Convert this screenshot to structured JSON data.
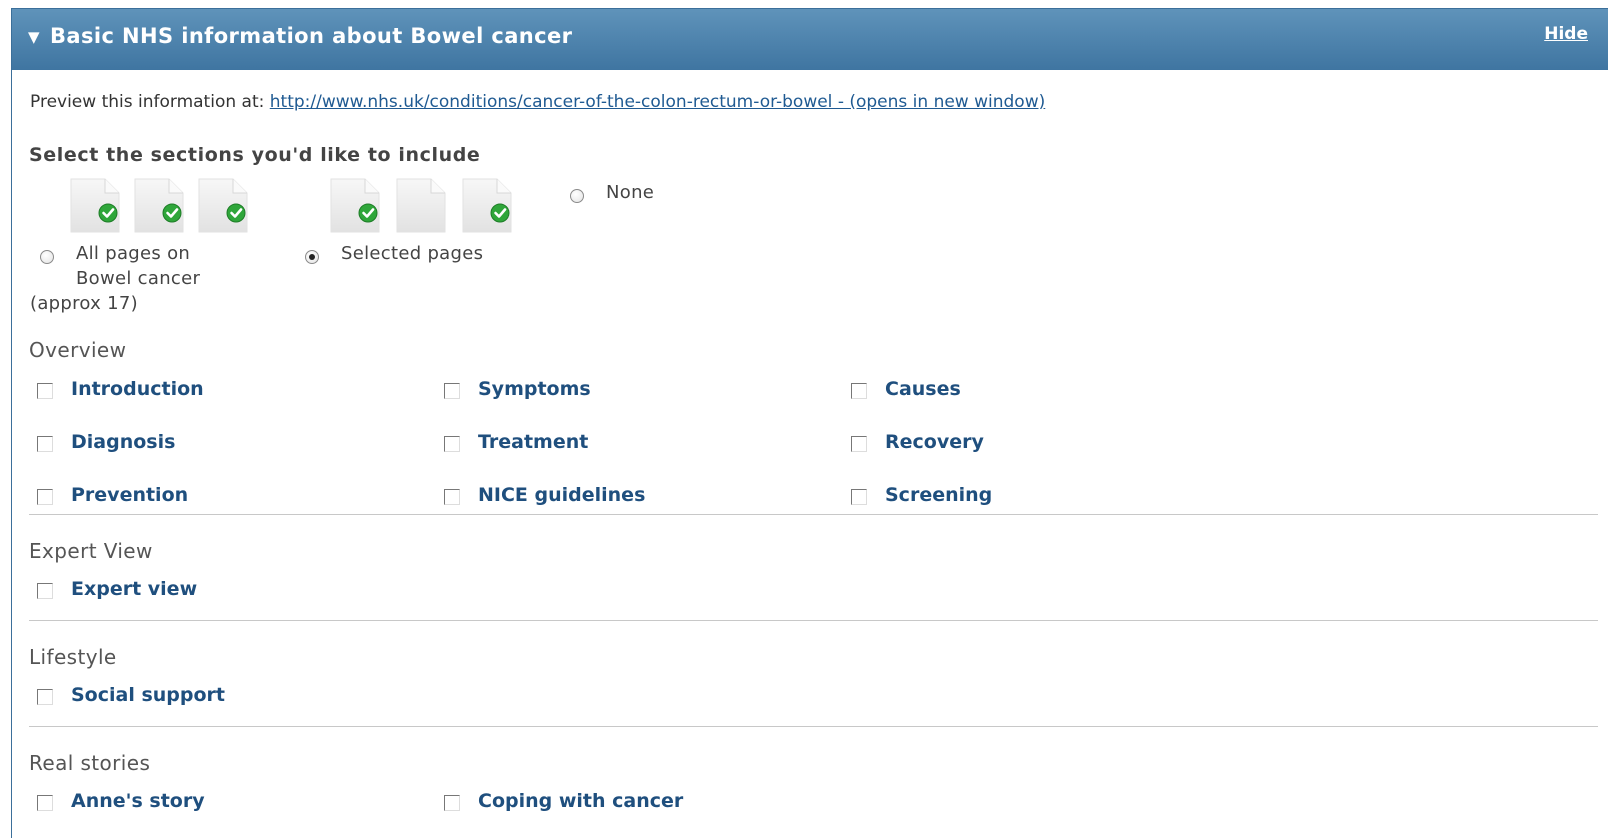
{
  "header": {
    "toggle_icon": "▼",
    "title": "Basic NHS information about Bowel cancer",
    "hide_label": "Hide"
  },
  "preview": {
    "label": "Preview this information at:",
    "link_text": "http://www.nhs.uk/conditions/cancer-of-the-colon-rectum-or-bowel - (opens in new window)"
  },
  "selection": {
    "heading": "Select the sections you'd like to include",
    "options": [
      {
        "line1": "All pages on",
        "line2": "Bowel cancer",
        "line3": "(approx 17)",
        "checked": false
      },
      {
        "label": "Selected pages",
        "checked": true
      },
      {
        "label": "None",
        "checked": false
      }
    ],
    "icons": {
      "document": "document-icon",
      "check": "green-check-icon",
      "check_color": "#2fa63a"
    }
  },
  "sections": [
    {
      "title": "Overview",
      "items": [
        "Introduction",
        "Symptoms",
        "Causes",
        "Diagnosis",
        "Treatment",
        "Recovery",
        "Prevention",
        "NICE guidelines",
        "Screening"
      ]
    },
    {
      "title": "Expert View",
      "items": [
        "Expert view"
      ]
    },
    {
      "title": "Lifestyle",
      "items": [
        "Social support"
      ]
    },
    {
      "title": "Real stories",
      "items": [
        "Anne's story",
        "Coping with cancer"
      ]
    }
  ],
  "colors": {
    "header_bg": "#4a80ab",
    "link": "#1f5a92",
    "item_text": "#1f4f7e"
  }
}
